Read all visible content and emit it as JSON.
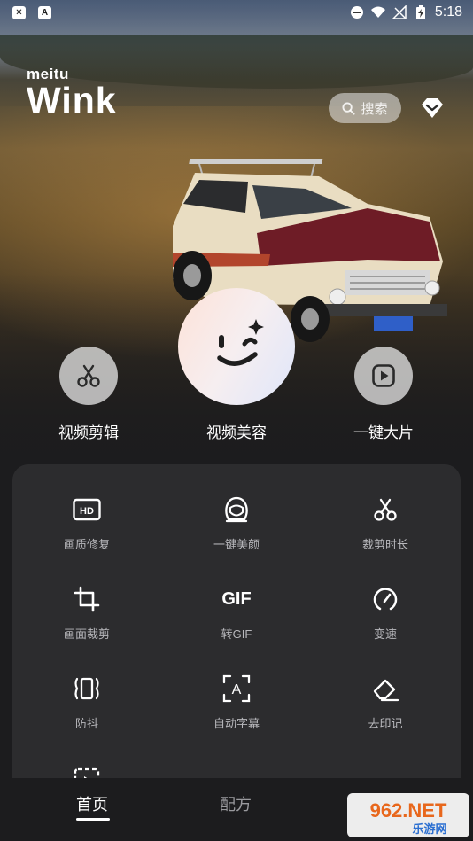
{
  "status_bar": {
    "left_icons": [
      "close-notification-icon",
      "font-app-icon"
    ],
    "time": "5:18"
  },
  "header": {
    "logo_small": "meitu",
    "logo_big": "Wink",
    "search_placeholder": "搜索"
  },
  "main_actions": [
    {
      "label": "视频剪辑",
      "icon": "scissors-icon"
    },
    {
      "label": "视频美容",
      "icon": "wink-face-icon"
    },
    {
      "label": "一键大片",
      "icon": "play-icon"
    }
  ],
  "tools": [
    {
      "label": "画质修复",
      "icon": "hd-icon"
    },
    {
      "label": "一键美颜",
      "icon": "face-outline-icon"
    },
    {
      "label": "裁剪时长",
      "icon": "scissors-icon"
    },
    {
      "label": "画面裁剪",
      "icon": "crop-icon"
    },
    {
      "label": "转GIF",
      "icon": "gif-icon",
      "icon_text": "GIF"
    },
    {
      "label": "变速",
      "icon": "speed-gauge-icon"
    },
    {
      "label": "防抖",
      "icon": "stabilize-icon"
    },
    {
      "label": "自动字幕",
      "icon": "auto-subtitle-icon",
      "icon_text": "A"
    },
    {
      "label": "去印记",
      "icon": "eraser-icon"
    }
  ],
  "bottom_nav": [
    {
      "label": "首页",
      "active": true
    },
    {
      "label": "配方",
      "active": false
    }
  ],
  "watermark": {
    "main": "962.NET",
    "sub": "乐游网"
  },
  "colors": {
    "panel_bg": "#2c2c2e",
    "page_bg": "#1c1c1e",
    "label_gray": "#b8b8bc",
    "beauty_gradient_start": "#fde2d8",
    "beauty_gradient_end": "#dfe6fa"
  }
}
